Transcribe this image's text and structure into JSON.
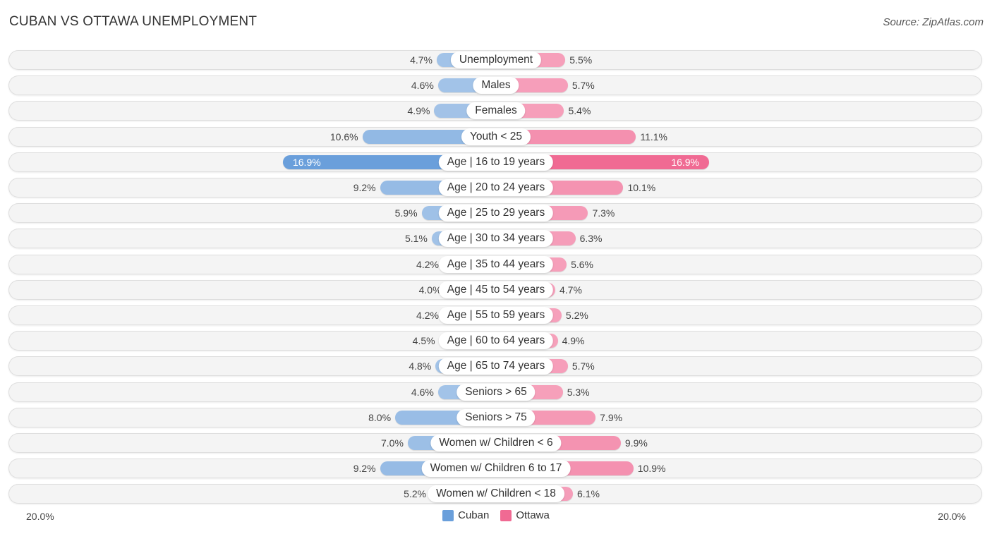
{
  "header": {
    "title": "CUBAN VS OTTAWA UNEMPLOYMENT",
    "source": "Source: ZipAtlas.com"
  },
  "colors": {
    "cuban": "#a4c4e8",
    "cuban_strong": "#6a9fdb",
    "ottawa": "#f6a3bd",
    "ottawa_strong": "#f06a93",
    "legend_cuban": "#6a9fdb",
    "legend_ottawa": "#f06a93"
  },
  "chart_data": {
    "type": "bar",
    "orientation": "horizontal-diverging",
    "title": "CUBAN VS OTTAWA UNEMPLOYMENT",
    "xlabel": "",
    "ylabel": "",
    "xlim": [
      -20.0,
      20.0
    ],
    "axis_labels": {
      "left": "20.0%",
      "right": "20.0%"
    },
    "legend": {
      "position": "bottom-center",
      "entries": [
        "Cuban",
        "Ottawa"
      ]
    },
    "unit": "%",
    "categories": [
      "Unemployment",
      "Males",
      "Females",
      "Youth < 25",
      "Age | 16 to 19 years",
      "Age | 20 to 24 years",
      "Age | 25 to 29 years",
      "Age | 30 to 34 years",
      "Age | 35 to 44 years",
      "Age | 45 to 54 years",
      "Age | 55 to 59 years",
      "Age | 60 to 64 years",
      "Age | 65 to 74 years",
      "Seniors > 65",
      "Seniors > 75",
      "Women w/ Children < 6",
      "Women w/ Children 6 to 17",
      "Women w/ Children < 18"
    ],
    "series": [
      {
        "name": "Cuban",
        "side": "left",
        "values": [
          4.7,
          4.6,
          4.9,
          10.6,
          16.9,
          9.2,
          5.9,
          5.1,
          4.2,
          4.0,
          4.2,
          4.5,
          4.8,
          4.6,
          8.0,
          7.0,
          9.2,
          5.2
        ],
        "labels": [
          "4.7%",
          "4.6%",
          "4.9%",
          "10.6%",
          "16.9%",
          "9.2%",
          "5.9%",
          "5.1%",
          "4.2%",
          "4.0%",
          "4.2%",
          "4.5%",
          "4.8%",
          "4.6%",
          "8.0%",
          "7.0%",
          "9.2%",
          "5.2%"
        ]
      },
      {
        "name": "Ottawa",
        "side": "right",
        "values": [
          5.5,
          5.7,
          5.4,
          11.1,
          16.9,
          10.1,
          7.3,
          6.3,
          5.6,
          4.7,
          5.2,
          4.9,
          5.7,
          5.3,
          7.9,
          9.9,
          10.9,
          6.1
        ],
        "labels": [
          "5.5%",
          "5.7%",
          "5.4%",
          "11.1%",
          "16.9%",
          "10.1%",
          "7.3%",
          "6.3%",
          "5.6%",
          "4.7%",
          "5.2%",
          "4.9%",
          "5.7%",
          "5.3%",
          "7.9%",
          "9.9%",
          "10.9%",
          "6.1%"
        ]
      }
    ],
    "highlighted_category": "Age | 16 to 19 years",
    "grid": false
  }
}
